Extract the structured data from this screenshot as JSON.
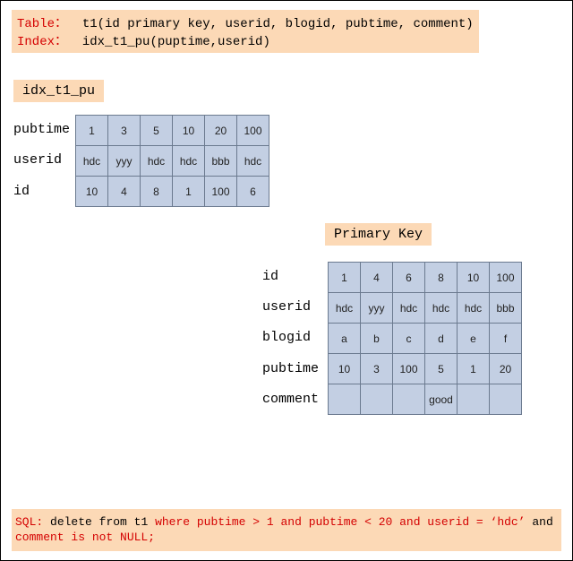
{
  "schema": {
    "table_label": "Table：",
    "table_def": "t1(id primary key, userid, blogid, pubtime, comment)",
    "index_label": "Index：",
    "index_def": "idx_t1_pu(puptime,userid)"
  },
  "idx": {
    "title": "idx_t1_pu",
    "rows": [
      "pubtime",
      "userid",
      "id"
    ],
    "data": [
      [
        "1",
        "3",
        "5",
        "10",
        "20",
        "100"
      ],
      [
        "hdc",
        "yyy",
        "hdc",
        "hdc",
        "bbb",
        "hdc"
      ],
      [
        "10",
        "4",
        "8",
        "1",
        "100",
        "6"
      ]
    ]
  },
  "pk": {
    "title": "Primary Key",
    "rows": [
      "id",
      "userid",
      "blogid",
      "pubtime",
      "comment"
    ],
    "data": [
      [
        "1",
        "4",
        "6",
        "8",
        "10",
        "100"
      ],
      [
        "hdc",
        "yyy",
        "hdc",
        "hdc",
        "hdc",
        "bbb"
      ],
      [
        "a",
        "b",
        "c",
        "d",
        "e",
        "f"
      ],
      [
        "10",
        "3",
        "100",
        "5",
        "1",
        "20"
      ],
      [
        "",
        "",
        "",
        "good",
        "",
        ""
      ]
    ]
  },
  "sql": {
    "label": "SQL:",
    "stmt_black": "delete from t1",
    "stmt_red_1": "where pubtime > 1 and pubtime < 20 and userid = ‘hdc’",
    "stmt_black_2": "and",
    "stmt_red_2": "comment is not NULL;"
  },
  "chart_data": [
    {
      "type": "table",
      "title": "idx_t1_pu",
      "row_headers": [
        "pubtime",
        "userid",
        "id"
      ],
      "rows": [
        [
          1,
          3,
          5,
          10,
          20,
          100
        ],
        [
          "hdc",
          "yyy",
          "hdc",
          "hdc",
          "bbb",
          "hdc"
        ],
        [
          10,
          4,
          8,
          1,
          100,
          6
        ]
      ]
    },
    {
      "type": "table",
      "title": "Primary Key",
      "row_headers": [
        "id",
        "userid",
        "blogid",
        "pubtime",
        "comment"
      ],
      "rows": [
        [
          1,
          4,
          6,
          8,
          10,
          100
        ],
        [
          "hdc",
          "yyy",
          "hdc",
          "hdc",
          "hdc",
          "bbb"
        ],
        [
          "a",
          "b",
          "c",
          "d",
          "e",
          "f"
        ],
        [
          10,
          3,
          100,
          5,
          1,
          20
        ],
        [
          "",
          "",
          "",
          "good",
          "",
          ""
        ]
      ]
    }
  ]
}
